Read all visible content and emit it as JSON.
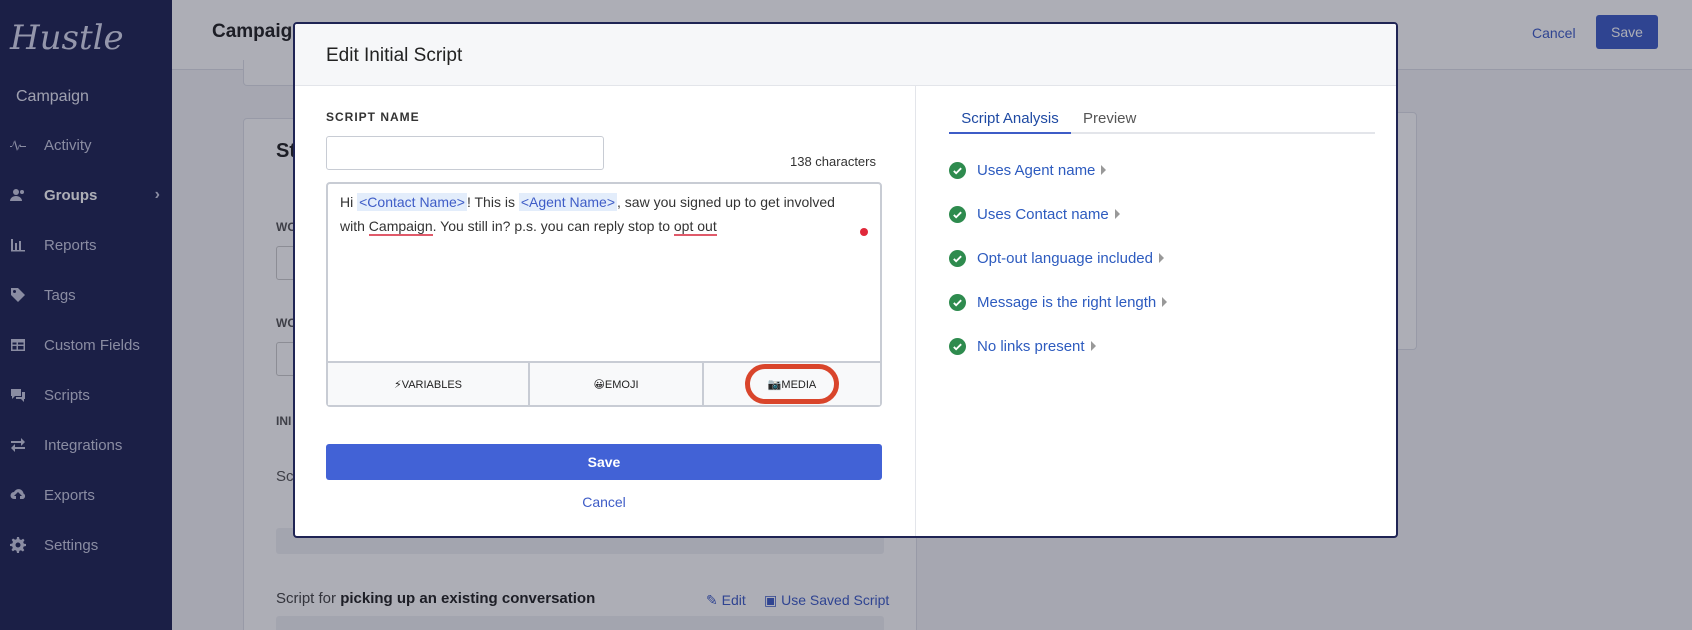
{
  "sidebar": {
    "logo": "Hustle",
    "campaign_label": "Campaign",
    "items": [
      {
        "label": "Activity",
        "icon": "activity-icon"
      },
      {
        "label": "Groups",
        "icon": "users-icon"
      },
      {
        "label": "Reports",
        "icon": "bar-chart-icon"
      },
      {
        "label": "Tags",
        "icon": "tag-icon"
      },
      {
        "label": "Custom Fields",
        "icon": "table-icon"
      },
      {
        "label": "Scripts",
        "icon": "chat-icon"
      },
      {
        "label": "Integrations",
        "icon": "arrows-icon"
      },
      {
        "label": "Exports",
        "icon": "cloud-upload-icon"
      },
      {
        "label": "Settings",
        "icon": "gear-icon"
      }
    ]
  },
  "page": {
    "title": "Campaign",
    "cancel_label": "Cancel",
    "save_label": "Save",
    "bg_section_title": "St",
    "bg_label_1": "WO",
    "bg_label_2": "WO",
    "bg_label_3": "INI",
    "bg_text": "Sc",
    "script_for_prefix": "Script for ",
    "script_for_bold": "picking up an existing conversation",
    "edit_label": "Edit",
    "use_saved_label": "Use Saved Script"
  },
  "modal": {
    "title": "Edit Initial Script",
    "script_name_label": "SCRIPT NAME",
    "script_name_value": "",
    "char_count": "138 characters",
    "script": {
      "t1": "Hi ",
      "contact_tag": "<Contact Name>",
      "t2": "! This is ",
      "agent_tag": "<Agent Name>",
      "t3": ", saw you signed up to get involved with ",
      "campaign_word": "Campaign",
      "t4": ". You still in? p.s. you can reply stop to ",
      "optout_word": "opt out"
    },
    "toolbar": {
      "variables": "⚡VARIABLES",
      "emoji": "😀EMOJI",
      "media": "📷MEDIA"
    },
    "save_label": "Save",
    "cancel_label": "Cancel",
    "tabs": {
      "analysis": "Script Analysis",
      "preview": "Preview"
    },
    "checks": [
      "Uses Agent name",
      "Uses Contact name",
      "Opt-out language included",
      "Message is the right length",
      "No links present"
    ],
    "accent_color": "#3e5cc7",
    "check_color": "#2e8b4e",
    "highlight_color": "#d9452b"
  }
}
